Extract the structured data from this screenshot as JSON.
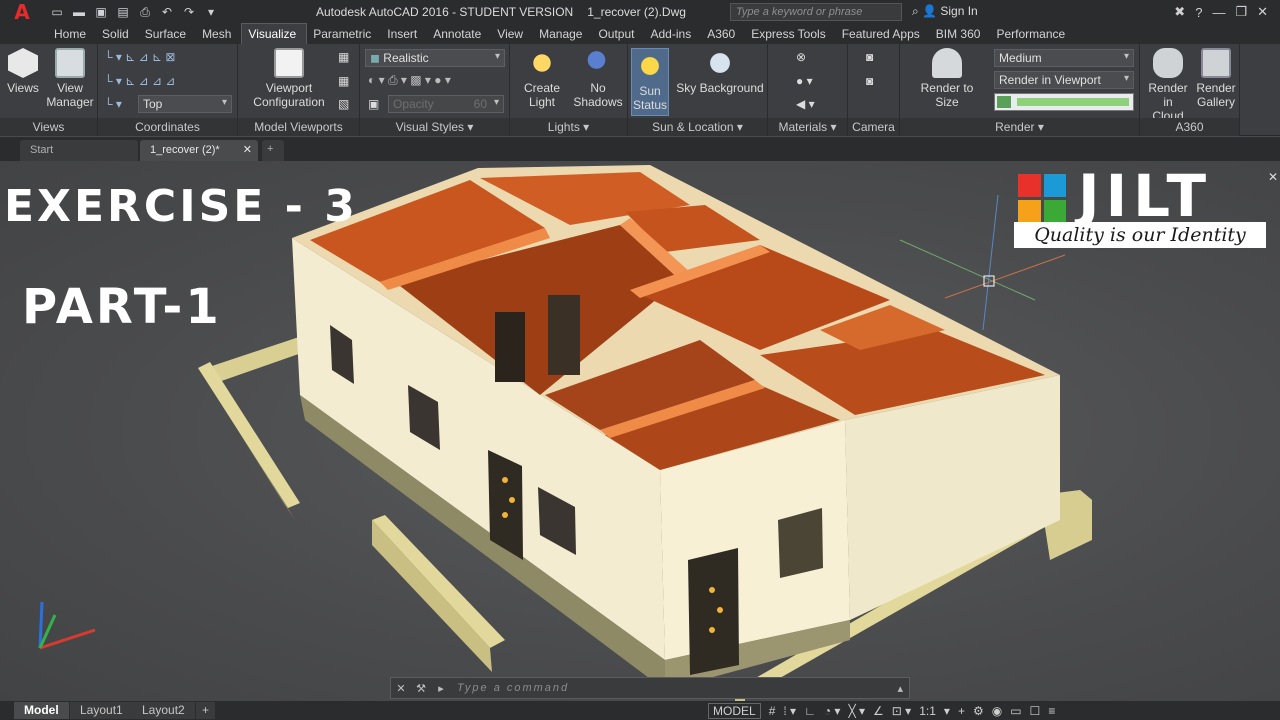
{
  "titlebar": {
    "app_letter": "A",
    "title": "Autodesk AutoCAD 2016 - STUDENT VERSION",
    "filename": "1_recover (2).Dwg",
    "search_placeholder": "Type a keyword or phrase",
    "signin_label": "Sign In"
  },
  "ribbon_tabs": [
    "Home",
    "Solid",
    "Surface",
    "Mesh",
    "Visualize",
    "Parametric",
    "Insert",
    "Annotate",
    "View",
    "Manage",
    "Output",
    "Add-ins",
    "A360",
    "Express Tools",
    "Featured Apps",
    "BIM 360",
    "Performance"
  ],
  "ribbon": {
    "views": {
      "btn1": "Views",
      "btn2a": "View",
      "btn2b": "Manager",
      "title": "Views"
    },
    "coordinates": {
      "ucs_select": "Top",
      "title": "Coordinates"
    },
    "model_viewports": {
      "btn_a": "Viewport",
      "btn_b": "Configuration",
      "title": "Model Viewports"
    },
    "visual_styles": {
      "style_select": "Realistic",
      "opacity_label": "Opacity",
      "opacity_value": "60",
      "title": "Visual Styles"
    },
    "lights": {
      "create_a": "Create",
      "create_b": "Light",
      "shadows_a": "No",
      "shadows_b": "Shadows",
      "title": "Lights"
    },
    "sun_location": {
      "sun_a": "Sun",
      "sun_b": "Status",
      "sky": "Sky Background",
      "title": "Sun & Location"
    },
    "materials": {
      "title": "Materials"
    },
    "camera": {
      "title": "Camera"
    },
    "render": {
      "render_to_size": "Render to Size",
      "quality_select": "Medium",
      "render_in_select": "Render in Viewport",
      "title": "Render"
    },
    "a360": {
      "cloud_a": "Render in",
      "cloud_b": "Cloud",
      "gallery_a": "Render",
      "gallery_b": "Gallery",
      "title": "A360"
    }
  },
  "doc_tabs": [
    "Start",
    "1_recover (2)*"
  ],
  "overlay": {
    "line1": "EXERCISE - 3",
    "line2": "PART-1"
  },
  "logo": {
    "word": "JILT",
    "tagline": "Quality is our Identity"
  },
  "command_line": {
    "placeholder": "Type a command"
  },
  "layout_tabs": [
    "Model",
    "Layout1",
    "Layout2"
  ],
  "status": {
    "model_label": "MODEL",
    "scale": "1:1"
  },
  "colors": {
    "logo_red": "#e8312a",
    "logo_orange": "#f5a11a",
    "logo_blue": "#1c9ad6",
    "logo_green": "#3aa935",
    "room_orange": "#e8743a",
    "wall_cream": "#f5efd2"
  }
}
